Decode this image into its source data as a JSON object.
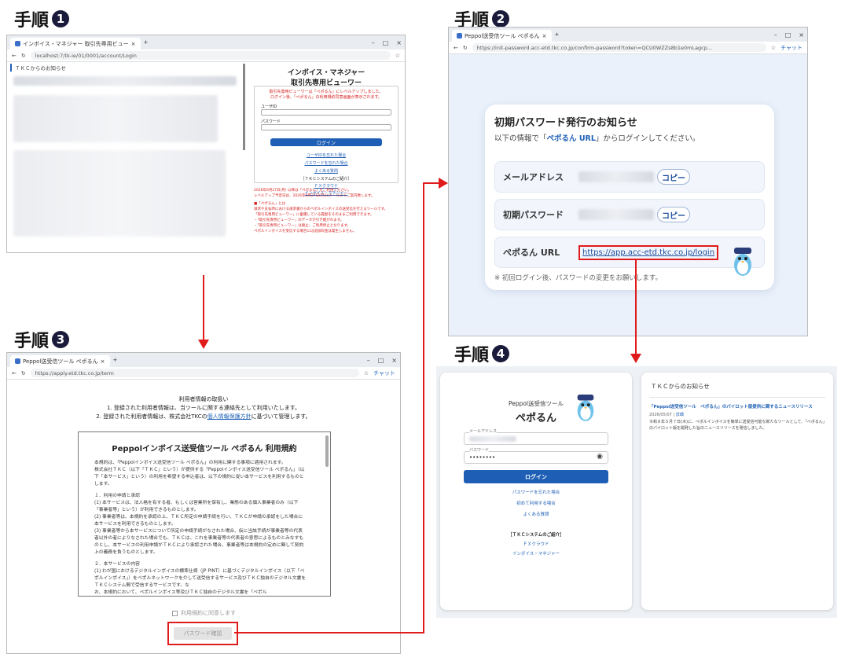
{
  "steps": {
    "s1": {
      "label": "手順",
      "num": "❶"
    },
    "s2": {
      "label": "手順",
      "num": "❷"
    },
    "s3": {
      "label": "手順",
      "num": "❸"
    },
    "s4": {
      "label": "手順",
      "num": "❹"
    }
  },
  "win1": {
    "tab": "インボイス・マネジャー 取引先専用ビュー",
    "url": "localhost:7/tk-ie/01/0001/account/Login",
    "notice_header": "ＴＫＣからのお知らせ",
    "title1": "インボイス・マネジャー",
    "title2": "取引先専用ビューワー",
    "red_msg1": "取引先専用ビューワーは「ぺポるん」にレベルアップしました。",
    "red_msg2": "ログイン後、「ぺポるん」の利用規約同意画面が表示されます。",
    "user_label": "ユーザID",
    "pass_label": "パスワード",
    "login": "ログイン",
    "link1": "ユーザIDを忘れた場合",
    "link2": "パスワードを忘れた場合",
    "link3": "よくある質問",
    "tkc_intro": "［ＴＫＣシステムのご紹介］",
    "link4": "ＦＸクラウド",
    "link5": "インボイス・マネジャー",
    "red_notice1": "2026年6月27日(月) 以降は「ぺポるん」をご利用ください。",
    "red_notice2": "レベルアップ予定日は、2026年6月27日(月)にメールにてご案内致します。",
    "red_notice3": "■「ぺポるん」とは",
    "red_notice4": "請求や支払時における請求書からのペポルインボイスの送受信を行えるツールです。",
    "red_notice5": "「取引先専用ビューワー」に蓄積している履歴をそのままご利用できます。",
    "red_notice6": "・「取引先専用ビューワー」のデータが引き継がれます。",
    "red_notice7": "・「取引先専用ビューワー」は廃止、ご利用停止となります。",
    "red_notice8": "ペポルインボイスを受信する場合には追加料金は発生しません。"
  },
  "win2": {
    "tab": "Peppol送受信ツール ぺポるん",
    "url": "https://init-password.acc-etd.tkc.co.jp/confirm-password?token=QCU0WZZs8b1e0mLagcp...",
    "chat": "チャット",
    "card_title": "初期パスワード発行のお知らせ",
    "card_sub_pre": "以下の情報で「",
    "card_sub_link": "ぺポるん URL",
    "card_sub_post": "」からログインしてください。",
    "row1_label": "メールアドレス",
    "row2_label": "初期パスワード",
    "row3_label": "ぺポるん URL",
    "copy": "コピー",
    "url_value": "https://app.acc-etd.tkc.co.jp/login",
    "footnote": "※ 初回ログイン後、パスワードの変更をお願いします。"
  },
  "win3": {
    "tab": "Peppol送受信ツール ぺポるん",
    "url": "https://apply.etd.tkc.co.jp/term",
    "chat": "チャット",
    "info_title": "利用者情報の取扱い",
    "info1": "1. 登録された利用者情報は、当ツールに関する連絡先として利用いたします。",
    "info2_pre": "2. 登録された利用者情報は、株式会社TKCの",
    "info2_link": "個人情報保護方針",
    "info2_post": "に基づいて管理します。",
    "terms_title": "Peppolインボイス送受信ツール ぺポるん 利用規約",
    "terms_p1": "本規約は、「Peppolインボイス送受信ツール ぺポるん」の利用に関する事項に適用されます。",
    "terms_p2": "株式会社ＴＫＣ（以下「ＴＫＣ」という）が提供する「Peppolインボイス送受信ツール ぺポるん」（以下「本サービス」という）の利用を希望する申込者は、以下の規約に従い本サービスを利用するものとします。",
    "terms_h1": "１．利用の申請と承認",
    "terms_l1": "(1) 本サービスは、法人格を有する者、もしくは営業所を保有し、業態のある個人事業者のみ（以下「事業者等」という）が利用できるものとします。",
    "terms_l2": "(2) 事業者等は、本規約を承認の上、ＴＫＣ所定の申請手続を行い、ＴＫＣが申請の承認をした場合に本サービスを利用できるものとします。",
    "terms_l3": "(3) 事業者等から本サービスについて所定の申請手続がなされた場合、仮に当該手続が事業者等の代表者以外の者によりなされた場合でも、ＴＫＣは、これを事業者等の代表者の意思によるものとみなすものとし、本サービスの利用申請がＴＫＣにより承認された場合、事業者等は本規約の定めに関して契約上の義務を負うものとします。",
    "terms_h2": "２．本サービスの内容",
    "terms_l4": "(1) わが国におけるデジタルインボイスの標準仕様（JP PINT）に基づくデジタルインボイス（以下「ペポルインボイス」）をペポルネットワークを介して送受信するサービス及びＴＫＣ独自のデジタル文書をＴＫＣシステム間で受信するサービスです。な",
    "terms_l5": "お、本規約において、ペポルインボイス等及びＴＫＣ独自のデジタル文書を「ペポル",
    "agree": "利用規約に同意します",
    "password_btn": "パスワード確認"
  },
  "win4": {
    "brand1": "Peppol送受信ツール",
    "brand2": "ぺポるん",
    "email_label": "メールアドレス",
    "pass_label": "パスワード",
    "pass_value": "••••••••",
    "login": "ログイン",
    "link1": "パスワードを忘れた場合",
    "link2": "初めて利用する場合",
    "link3": "よくある質問",
    "tkc_intro": "［ＴＫＣシステムのご紹介］",
    "link4": "ＦＸクラウド",
    "link5": "インボイス・マネジャー",
    "notice_header": "ＴＫＣからのお知らせ",
    "news_title": "「Peppol送受信ツール　ぺポるん」のパイロット版提供に関するニュースリリース",
    "news_date": "2026/05/07",
    "news_detail": "詳細",
    "news_body": "令和８年５月７日(木)に、ペポルインボイスを簡単に送受信可能な新たなツールとして、「ぺポるん」のパイロット版を開発した旨のニュースリリースを発信しました。"
  },
  "colors": {
    "accent": "#1e5fb5",
    "highlight": "#e01b1b"
  }
}
